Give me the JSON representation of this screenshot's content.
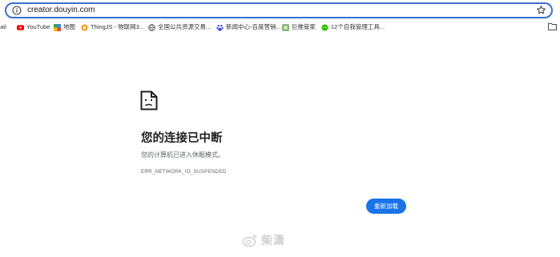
{
  "address_bar": {
    "url": "creator.douyin.com"
  },
  "bookmarks": [
    {
      "label": "mail",
      "icon": "gmail-icon"
    },
    {
      "label": "YouTube",
      "icon": "youtube-icon"
    },
    {
      "label": "地图",
      "icon": "maps-icon"
    },
    {
      "label": "ThingJS - 物联网3...",
      "icon": "thingjs-icon"
    },
    {
      "label": "全国公共资源交易...",
      "icon": "globe-icon"
    },
    {
      "label": "新闻中心-百度营销...",
      "icon": "baidu-icon"
    },
    {
      "label": "巨推管家",
      "icon": "site-icon"
    },
    {
      "label": "12个自我管理工具...",
      "icon": "wechat-icon"
    }
  ],
  "error": {
    "title": "您的连接已中断",
    "description": "您的计算机已进入休眠模式。",
    "code": "ERR_NETWORK_IO_SUSPENDED",
    "reload_label": "重新加载"
  },
  "watermark": {
    "text": "柴潇"
  },
  "colors": {
    "accent": "#1a73e8",
    "omnibox_border": "#3b6fd3"
  }
}
